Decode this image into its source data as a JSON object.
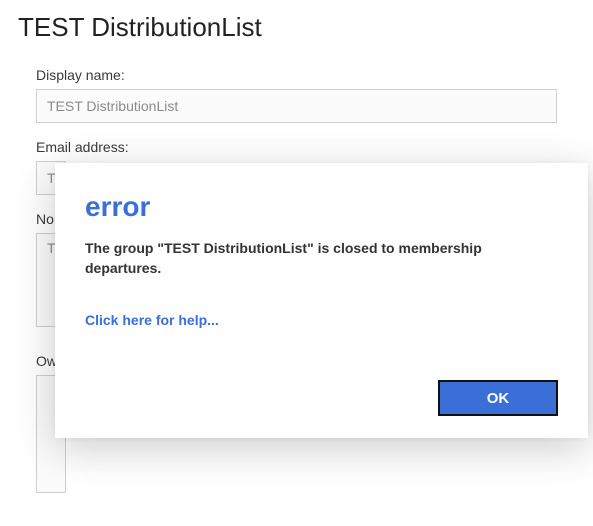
{
  "page": {
    "title": "TEST DistributionList"
  },
  "form": {
    "displayName": {
      "label": "Display name:",
      "value": "TEST DistributionList"
    },
    "emailAddress": {
      "label": "Email address:",
      "value": "T"
    },
    "notes": {
      "label": "No",
      "value": "T"
    },
    "owners": {
      "label": "Ow",
      "value": ""
    }
  },
  "dialog": {
    "title": "error",
    "message": "The group \"TEST DistributionList\" is closed to membership departures.",
    "helpLink": "Click here for help...",
    "okLabel": "OK"
  }
}
